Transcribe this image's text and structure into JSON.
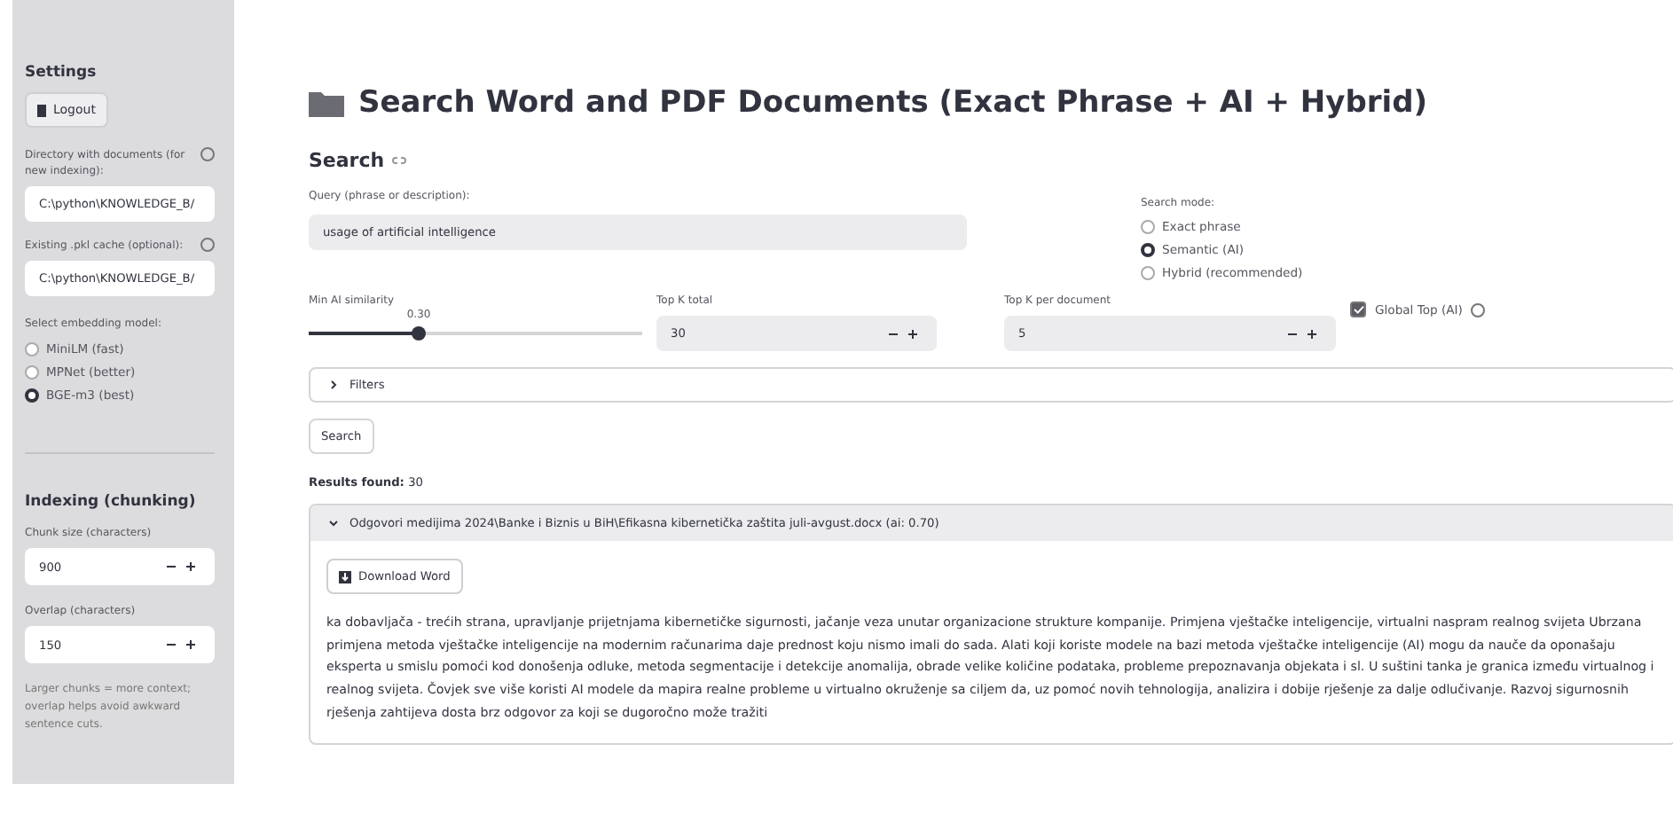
{
  "sidebar": {
    "title": "Settings",
    "logout_button": "Logout",
    "fields": [
      {
        "label": "Directory with documents (for new indexing):",
        "value": "C:\\python\\KNOWLEDGE_B/"
      },
      {
        "label": "Existing .pkl cache (optional):",
        "value": "C:\\python\\KNOWLEDGE_B/"
      }
    ],
    "model_label": "Select embedding model:",
    "models": [
      {
        "label": "MiniLM (fast)",
        "selected": false
      },
      {
        "label": "MPNet (better)",
        "selected": false
      },
      {
        "label": "BGE-m3 (best)",
        "selected": true
      }
    ],
    "indexing_title": "Indexing (chunking)",
    "number_fields": [
      {
        "label": "Chunk size (characters)",
        "value": "900"
      },
      {
        "label": "Overlap (characters)",
        "value": "150"
      }
    ],
    "help": "Larger chunks = more context; overlap helps avoid awkward sentence cuts."
  },
  "main": {
    "title": "Search Word and PDF Documents (Exact Phrase + AI + Hybrid)",
    "section": "Search",
    "query": {
      "label": "Query (phrase or description):",
      "value": "usage of artificial intelligence"
    },
    "mode_label": "Search mode:",
    "modes": [
      {
        "label": "Exact phrase",
        "selected": false
      },
      {
        "label": "Semantic (AI)",
        "selected": true
      },
      {
        "label": "Hybrid (recommended)",
        "selected": false
      }
    ],
    "similarity": {
      "label": "Min AI similarity",
      "reading": "0.30",
      "level": 0.33
    },
    "top_k": [
      {
        "label": "Top K total",
        "value": "30"
      },
      {
        "label": "Top K per document",
        "value": "5"
      }
    ],
    "global_top": {
      "label": "Global Top (AI)",
      "checked": true
    },
    "filters": {
      "label": "Filters",
      "expanded": false
    },
    "search_button": "Search",
    "results_label": "Results found:",
    "results_count": "30",
    "result": {
      "title": "Odgovori medijima 2024\\Banke i Biznis u BiH\\Efikasna kibernetička zaštita juli-avgust.docx (ai: 0.70)",
      "expanded": true,
      "download_button": "Download Word",
      "text": "ka dobavljača - trećih strana, upravljanje prijetnjama kibernetičke sigurnosti, jačanje veza unutar organizacione strukture kompanije. Primjena vještačke inteligencije, virtualni naspram realnog svijeta Ubrzana primjena metoda vještačke inteligencije na modernim računarima daje prednost koju nismo imali do sada. Alati koji koriste modele na bazi metoda vještačke inteligencije (AI) mogu da nauče da oponašaju eksperta u smislu pomoći kod donošenja odluke, metoda segmentacije i detekcije anomalija, obrade velike količine podataka, probleme prepoznavanja objekata i sl. U suštini tanka je granica između virtualnog i realnog svijeta. Čovjek sve više koristi AI modele da mapira realne probleme u virtualno okruženje sa ciljem da, uz pomoć novih tehnologija, analizira i dobije rješenje za dalje odlučivanje. Razvoj sigurnosnih rješenja zahtijeva dosta brz odgovor za koji se dugoročno može tražiti"
    }
  }
}
